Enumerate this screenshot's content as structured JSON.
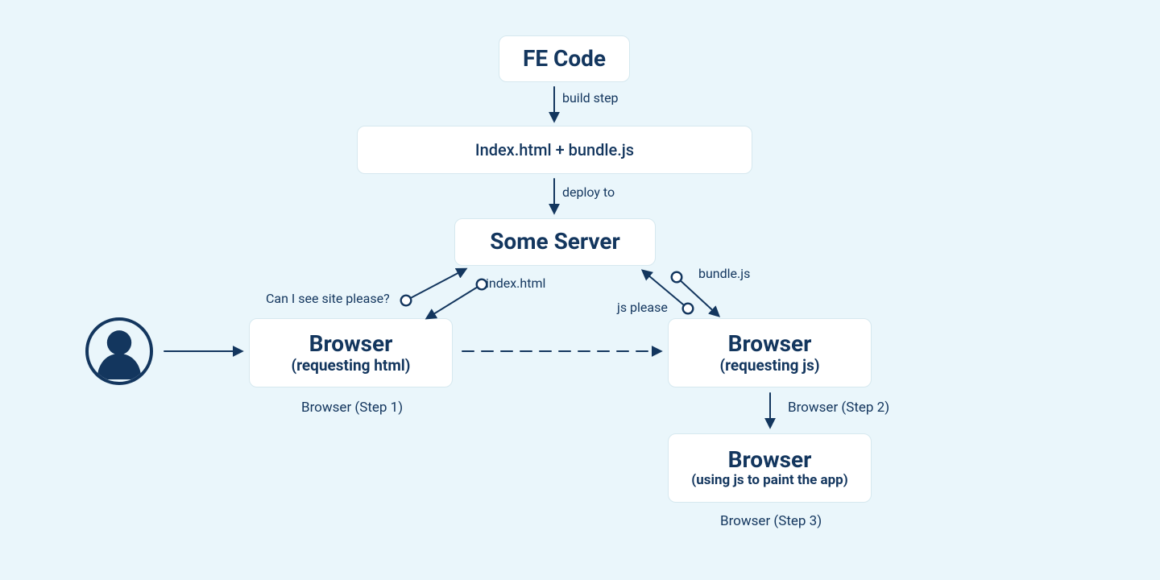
{
  "colors": {
    "ink": "#13365e",
    "bg": "#eaf6fb",
    "nodeBorder": "#d6e8ef",
    "nodeBg": "#ffffff"
  },
  "nodes": {
    "feCode": {
      "title": "FE Code"
    },
    "artifacts": {
      "title": "Index.html + bundle.js"
    },
    "server": {
      "title": "Some Server"
    },
    "browser1": {
      "title": "Browser",
      "subtitle": "(requesting html)"
    },
    "browser2": {
      "title": "Browser",
      "subtitle": "(requesting js)"
    },
    "browser3": {
      "title": "Browser",
      "subtitle": "(using js to paint the app)"
    }
  },
  "edges": {
    "buildStep": "build step",
    "deployTo": "deploy to",
    "reqSite": "Can I see site please?",
    "indexHtml": "index.html",
    "jsPlease": "js please",
    "bundleJs": "bundle.js"
  },
  "captions": {
    "step1": "Browser (Step 1)",
    "step2": "Browser (Step 2)",
    "step3": "Browser (Step 3)"
  },
  "icons": {
    "user": "user-icon"
  }
}
